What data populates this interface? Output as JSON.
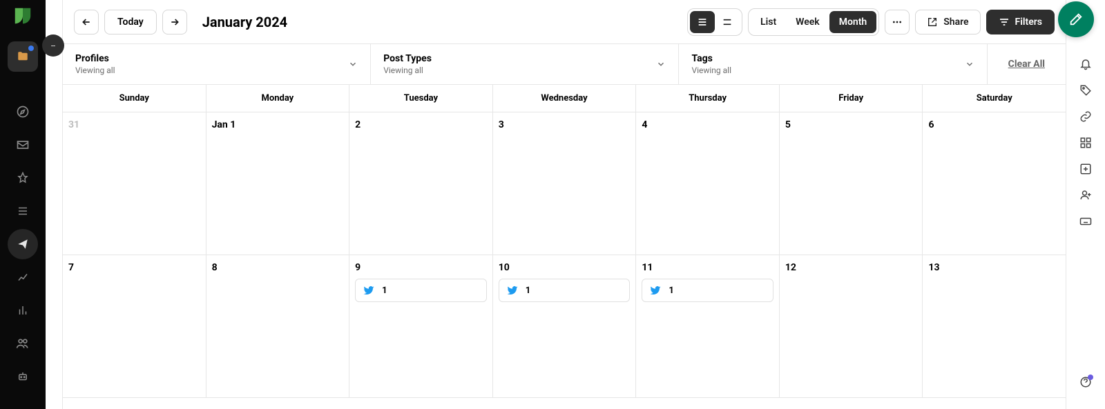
{
  "header": {
    "title": "January 2024",
    "today": "Today",
    "views": {
      "list": "List",
      "week": "Week",
      "month": "Month"
    },
    "share": "Share",
    "filters": "Filters"
  },
  "filters": {
    "profiles": {
      "label": "Profiles",
      "sub": "Viewing all"
    },
    "postTypes": {
      "label": "Post Types",
      "sub": "Viewing all"
    },
    "tags": {
      "label": "Tags",
      "sub": "Viewing all"
    },
    "clear": "Clear All"
  },
  "weekdays": [
    "Sunday",
    "Monday",
    "Tuesday",
    "Wednesday",
    "Thursday",
    "Friday",
    "Saturday"
  ],
  "calendar": {
    "rows": [
      [
        {
          "label": "31",
          "muted": true
        },
        {
          "label": "Jan 1"
        },
        {
          "label": "2"
        },
        {
          "label": "3"
        },
        {
          "label": "4"
        },
        {
          "label": "5"
        },
        {
          "label": "6"
        }
      ],
      [
        {
          "label": "7"
        },
        {
          "label": "8"
        },
        {
          "label": "9",
          "posts": [
            {
              "net": "twitter",
              "count": "1"
            }
          ]
        },
        {
          "label": "10",
          "posts": [
            {
              "net": "twitter",
              "count": "1"
            }
          ]
        },
        {
          "label": "11",
          "posts": [
            {
              "net": "twitter",
              "count": "1"
            }
          ]
        },
        {
          "label": "12"
        },
        {
          "label": "13"
        }
      ]
    ]
  }
}
